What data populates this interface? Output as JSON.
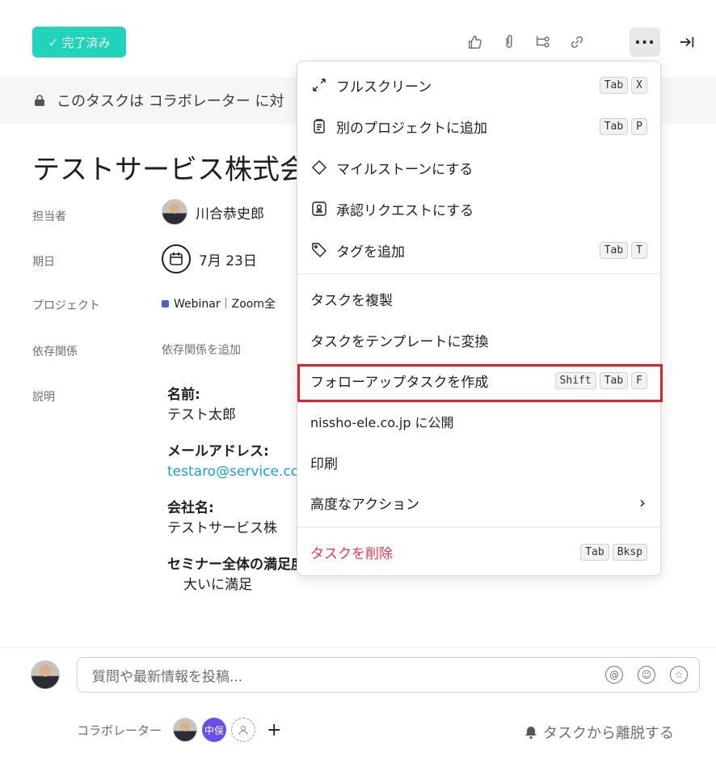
{
  "header": {
    "complete_label": "✓ 完了済み",
    "icons": [
      "thumbs-up-icon",
      "attachment-icon",
      "subtask-icon",
      "link-icon",
      "more-icon",
      "close-panel-icon"
    ]
  },
  "notice": {
    "text": "このタスクは コラボレーター に対"
  },
  "task": {
    "title": "テストサービス株式会",
    "fields": {
      "assignee_label": "担当者",
      "assignee_value": "川合恭史郎",
      "due_label": "期日",
      "due_value": "7月 23日",
      "project_label": "プロジェクト",
      "project_value": "Webinar｜Zoom全",
      "dependency_label": "依存関係",
      "dependency_value": "依存関係を追加",
      "description_label": "説明"
    },
    "description": [
      {
        "heading": "名前:",
        "value": "テスト太郎"
      },
      {
        "heading": "メールアドレス:",
        "value": "testaro@service.cc"
      },
      {
        "heading": "会社名:",
        "value": "テストサービス株"
      },
      {
        "heading": "セミナー全体の満足度:",
        "value": "大いに満足"
      }
    ]
  },
  "menu": {
    "items": [
      {
        "label": "フルスクリーン",
        "icon": "expand-icon",
        "keys": [
          "Tab",
          "X"
        ]
      },
      {
        "label": "別のプロジェクトに追加",
        "icon": "clipboard-icon",
        "keys": [
          "Tab",
          "P"
        ]
      },
      {
        "label": "マイルストーンにする",
        "icon": "diamond-icon",
        "keys": []
      },
      {
        "label": "承認リクエストにする",
        "icon": "approval-icon",
        "keys": []
      },
      {
        "label": "タグを追加",
        "icon": "tag-icon",
        "keys": [
          "Tab",
          "T"
        ]
      },
      {
        "label": "タスクを複製",
        "keys": []
      },
      {
        "label": "タスクをテンプレートに変換",
        "keys": []
      },
      {
        "label": "フォローアップタスクを作成",
        "keys": [
          "Shift",
          "Tab",
          "F"
        ]
      },
      {
        "label": "nissho-ele.co.jp に公開",
        "keys": []
      },
      {
        "label": "印刷",
        "keys": []
      },
      {
        "label": "高度なアクション",
        "keys": []
      },
      {
        "label": "タスクを削除",
        "keys": [
          "Tab",
          "Bksp"
        ]
      }
    ],
    "advanced_chevron": "›"
  },
  "comment": {
    "placeholder": "質問や最新情報を投稿...",
    "collaborators_label": "コラボレーター",
    "collaborator_badge": "中俣",
    "add_symbol": "+",
    "leave_label": "タスクから離脱する"
  },
  "colors": {
    "accent_green": "#20d4b9",
    "highlight_red": "#e0232a",
    "danger": "#e8384f",
    "link": "#1b9fd8"
  }
}
